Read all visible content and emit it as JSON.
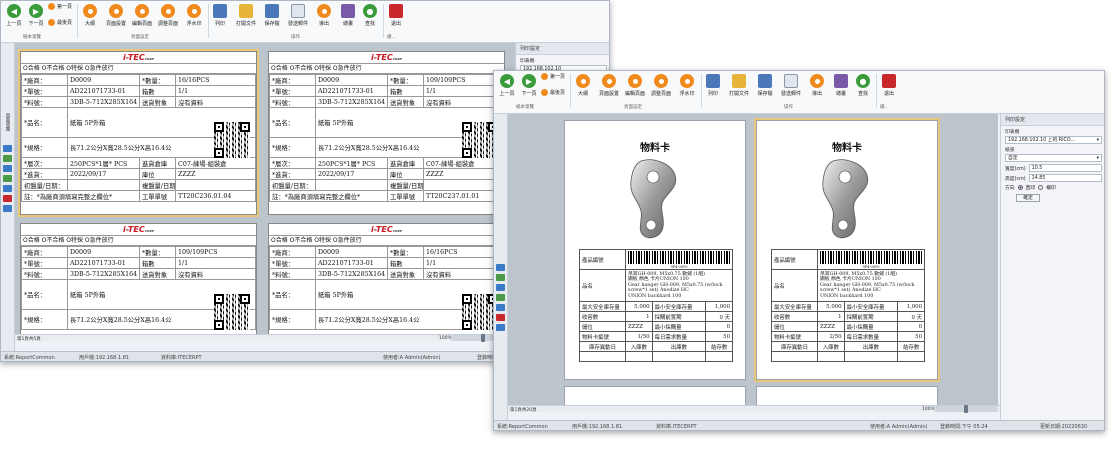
{
  "ribbon": {
    "prev_page": "上一頁",
    "next_page": "下一頁",
    "first_page": "第一頁",
    "last_page": "最後頁",
    "big": "大綱",
    "page_setup": "頁面設置",
    "edit_page": "編輯頁面",
    "adjust_page": "調整頁面",
    "watermark": "浮水印",
    "print": "列印",
    "open_file": "打開文件",
    "save": "保存檔",
    "send_email": "發送郵件",
    "export": "導出",
    "sign": "總畫",
    "find": "查找",
    "exit": "退出",
    "group_nav": "紙本瀏覽",
    "group_page": "頁面設定",
    "group_ops": "操作",
    "group_misc": "總..."
  },
  "label_cards": [
    {
      "checks": "O合格 O不合格 O特採 O急件放行",
      "vendor_label": "*廠商：",
      "vendor": "D0009",
      "qty_label": "*數量：",
      "qty": "16/16PCS",
      "order_label": "*單號：",
      "order": "AD221071733-01",
      "box_label": "箱數",
      "box": "1/1",
      "part_label": "*料號：",
      "part": "3DB-5-712X285X164",
      "dest_label": "送貨對象",
      "dest": "沒有資料",
      "name_label": "*品名：",
      "name": "紙箱 5P外箱",
      "spec_label": "*規格：",
      "spec": "長71.2公分X寬28.5公分X高16.4公",
      "lot_label": "*層次：",
      "lot": "250PCS*1層*    PCS",
      "wh_label": "進貨倉庫",
      "wh": "C07-練場-組裝倉",
      "date_label": "*進貨：",
      "date": "2022/09/17",
      "zone_label": "庫位",
      "zone": "ZZZZ",
      "insp_label": "初盤量/日期：",
      "recheck_label": "複盤量/日期：",
      "note": "註：*為廠商須填寫完整之欄位*",
      "wo_label": "工單單號",
      "wo": "TT20C236.01.04"
    },
    {
      "checks": "O合格 O不合格 O特採 O急件放行",
      "vendor_label": "*廠商：",
      "vendor": "D0009",
      "qty_label": "*數量：",
      "qty": "109/109PCS",
      "order_label": "*單號：",
      "order": "AD221071733-01",
      "box_label": "箱數",
      "box": "1/1",
      "part_label": "*料號：",
      "part": "3DB-5-712X285X164",
      "dest_label": "送貨對象",
      "dest": "沒有資料",
      "name_label": "*品名：",
      "name": "紙箱 5P外箱",
      "spec_label": "*規格：",
      "spec": "長71.2公分X寬28.5公分X高16.4公",
      "lot_label": "*層次：",
      "lot": "250PCS*1層*    PCS",
      "wh_label": "進貨倉庫",
      "wh": "C07-練場-組裝倉",
      "date_label": "*進貨：",
      "date": "2022/09/17",
      "zone_label": "庫位",
      "zone": "ZZZZ",
      "insp_label": "初盤量/日期：",
      "recheck_label": "複盤量/日期：",
      "note": "註：*為廠商須填寫完整之欄位*",
      "wo_label": "工單單號",
      "wo": "TT20C237.01.01"
    },
    {
      "checks": "O合格 O不合格 O特採 O急件放行",
      "vendor_label": "*廠商：",
      "vendor": "D0009",
      "qty_label": "*數量：",
      "qty": "109/109PCS",
      "order_label": "*單號：",
      "order": "AD221071733-01",
      "box_label": "箱數",
      "box": "1/1",
      "part_label": "*料號：",
      "part": "3DB-5-712X285X164",
      "dest_label": "送貨對象",
      "dest": "沒有資料",
      "name_label": "*品名：",
      "name": "紙箱 5P外箱",
      "spec_label": "*規格：",
      "spec": "長71.2公分X寬28.5公分X高16.4公"
    },
    {
      "checks": "O合格 O不合格 O特採 O急件放行",
      "vendor_label": "*廠商：",
      "vendor": "D0009",
      "qty_label": "*數量：",
      "qty": "16/16PCS",
      "order_label": "*單號：",
      "order": "AD221071733-01",
      "box_label": "箱數",
      "box": "1/1",
      "part_label": "*料號：",
      "part": "3DB-5-712X285X164",
      "dest_label": "送貨對象",
      "dest": "沒有資料",
      "name_label": "*品名：",
      "name": "紙箱 5P外箱",
      "spec_label": "*規格：",
      "spec": "長71.2公分X寬28.5公分X高16.4公"
    }
  ],
  "logo": "i-TEC",
  "logo_sub": "CORP",
  "w1": {
    "left_strip_label": "頁面導覽",
    "page_nav": "第1頁共5頁",
    "zoom": "100%",
    "side_title": "列印設定",
    "side_printer_label": "印表機",
    "side_printer": "192.168.102.10",
    "status_sys": "系統:ReportCommon",
    "status_ip": "用戶機:192.168.1.81",
    "status_db": "資料庫:ITECERPT",
    "status_user": "使用者:A Admin(Admin)",
    "status_time": "登錄時間:下午 05:2..."
  },
  "w2": {
    "page_nav": "第1頁共20頁",
    "zoom": "100%",
    "side_title": "列印設定",
    "printer_label": "印表機",
    "printer": "192.168.102.10 上的 RICO...",
    "paper_label": "紙張",
    "paper": "自定",
    "width_label": "寬度(cm)",
    "width": "10.5",
    "height_label": "高度(cm)",
    "height": "14.85",
    "orient_label": "方向",
    "portrait": "直印",
    "landscape": "橫印",
    "ok": "確定",
    "status_sys": "系統:ReportCommon",
    "status_ip": "用戶機:192.168.1.81",
    "status_db": "資料庫:ITECERPT",
    "status_user": "使用者:A Admin(Admin)",
    "status_time": "登錄時間:下午 05:24",
    "status_ver": "更新日期:20220630"
  },
  "material_cards": [
    {
      "title": "物料卡",
      "barcode_no": "9P4-0009",
      "name_label": "產品編號",
      "pn_label": "品名",
      "pn": "吊耳GH-009, M5x0.75 數鋪 (1組)",
      "pn2": "鋼板 顏色 卡片UNION 100",
      "pn3": "Gear hanger GH-009, M5x0.75  (w/lock",
      "pn4": "screw*1 set) Anodize HC",
      "pn5": "UNION backhard 100",
      "max_label": "最大安全庫存量",
      "max": "5,000",
      "min_label": "最小安全庫存量",
      "min": "1,000",
      "recv_label": "收容數",
      "recv": "1",
      "cycle_label": "採購前置期",
      "cycle": "0 天",
      "loc_label": "儲位",
      "loc": "ZZZZ",
      "minpack_label": "最小採購量",
      "minpack": "0",
      "page_label": "物料卡編號",
      "page": "1/50",
      "daily_label": "每日需求數量",
      "daily": "50",
      "h1": "庫存異動日",
      "h2": "入庫數",
      "h3": "出庫數",
      "h4": "結存數"
    },
    {
      "title": "物料卡",
      "barcode_no": "9P4-0009",
      "name_label": "產品編號",
      "pn_label": "品名",
      "pn": "吊耳GH-009, M5x0.75 數鋪 (1組)",
      "pn2": "鋼板 顏色 卡片UNION 100",
      "pn3": "Gear hanger GH-009, M5x0.75  (w/lock",
      "pn4": "screw*1 set) Anodize HC",
      "pn5": "UNION backhard 100",
      "max_label": "最大安全庫存量",
      "max": "5,000",
      "min_label": "最小安全庫存量",
      "min": "1,000",
      "recv_label": "收容數",
      "recv": "1",
      "cycle_label": "採購前置期",
      "cycle": "0 天",
      "loc_label": "儲位",
      "loc": "ZZZZ",
      "minpack_label": "最小採購量",
      "minpack": "0",
      "page_label": "物料卡編號",
      "page": "2/50",
      "daily_label": "每日需求數量",
      "daily": "50",
      "h1": "庫存異動日",
      "h2": "入庫數",
      "h3": "出庫數",
      "h4": "結存數"
    }
  ],
  "colors": {
    "accent_orange": "#f08a1c",
    "nav_green": "#3a9b3a",
    "logo_red": "#c8141c",
    "selection": "#e8c77a"
  }
}
